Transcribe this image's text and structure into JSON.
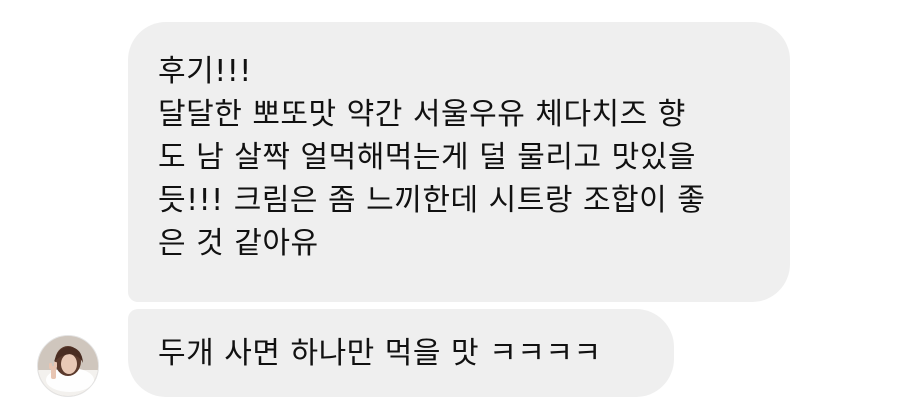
{
  "messages": [
    {
      "lines": [
        "후기!!!",
        "달달한 뽀또맛 약간 서울우유 체다치즈 향",
        "도 남 살짝 얼먹해먹는게 덜 물리고 맛있을",
        "듯!!! 크림은 좀 느끼한데 시트랑 조합이 좋",
        "은 것 같아유"
      ]
    },
    {
      "text": "두개 사면 하나만 먹을 맛 ㅋㅋㅋㅋ"
    }
  ],
  "sender": {
    "avatar_icon": "profile-photo-avatar"
  },
  "colors": {
    "bubble_background": "#efefef",
    "text": "#111111",
    "page_background": "#ffffff"
  }
}
